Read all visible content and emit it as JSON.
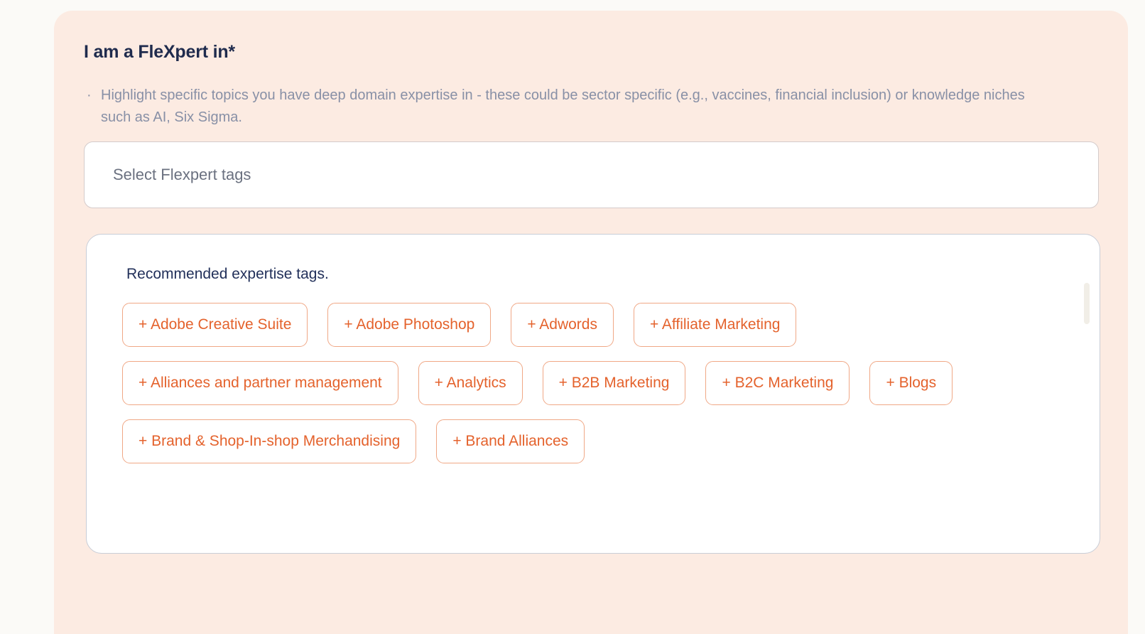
{
  "form": {
    "section_title": "I am a FleXpert in*",
    "helper_bullet_glyph": "·",
    "helper_text": "Highlight specific topics you have deep domain expertise in - these could be sector specific (e.g., vaccines, financial inclusion) or knowledge niches such as AI, Six Sigma.",
    "select": {
      "placeholder": "Select Flexpert tags",
      "value": ""
    },
    "recommended": {
      "title": "Recommended expertise tags.",
      "tags": [
        "+ Adobe Creative Suite",
        "+ Adobe Photoshop",
        "+ Adwords",
        "+ Affiliate Marketing",
        "+ Alliances and partner management",
        "+ Analytics",
        "+ B2B Marketing",
        "+ B2C Marketing",
        "+ Blogs",
        "+ Brand & Shop-In-shop Merchandising",
        "+ Brand Alliances"
      ]
    }
  },
  "colors": {
    "page_background": "#FBFAF7",
    "card_background": "#FCEBE2",
    "panel_background": "#FFFFFF",
    "panel_border": "#C8CDD7",
    "select_border": "#D4CBCB",
    "heading_text": "#1F2B4D",
    "helper_text": "#8890A6",
    "placeholder_text": "#6B7180",
    "tag_text": "#E4622C",
    "tag_border": "#F0A886",
    "scrollbar_thumb": "#F1EEE7"
  }
}
